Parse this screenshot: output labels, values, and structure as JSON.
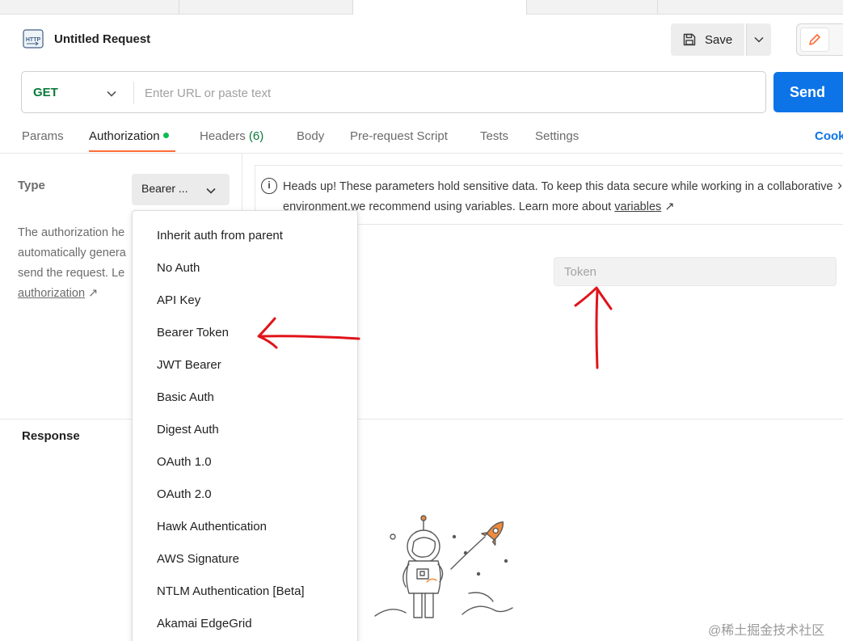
{
  "request": {
    "title": "Untitled Request",
    "http_badge": "HTTP",
    "save_label": "Save",
    "method": "GET",
    "url_placeholder": "Enter URL or paste text",
    "send_label": "Send"
  },
  "tabs": [
    {
      "label": "Params"
    },
    {
      "label": "Authorization",
      "active": true,
      "dot": true
    },
    {
      "label": "Headers",
      "count": "(6)"
    },
    {
      "label": "Body"
    },
    {
      "label": "Pre-request Script"
    },
    {
      "label": "Tests"
    },
    {
      "label": "Settings"
    }
  ],
  "cookies_label": "Cook",
  "auth": {
    "type_label": "Type",
    "selected_type": "Bearer ...",
    "description": {
      "line1": "The authorization he",
      "line2": "automatically genera",
      "line3": "send the request. Le",
      "link": "authorization",
      "link_arrow": "↗"
    }
  },
  "banner": {
    "text": "Heads up! These parameters hold sensitive data. To keep this data secure while working in a collaborative environment,we recommend using variables. Learn more about ",
    "link": "variables",
    "link_arrow": "↗"
  },
  "token_placeholder": "Token",
  "dropdown": {
    "items": [
      "Inherit auth from parent",
      "No Auth",
      "API Key",
      "Bearer Token",
      "JWT Bearer",
      "Basic Auth",
      "Digest Auth",
      "OAuth 1.0",
      "OAuth 2.0",
      "Hawk Authentication",
      "AWS Signature",
      "NTLM Authentication [Beta]",
      "Akamai EdgeGrid"
    ]
  },
  "response_label": "Response",
  "watermark": "@稀土掘金技术社区",
  "colors": {
    "accent_orange": "#ff6c37",
    "send_blue": "#0d74e7",
    "method_green": "#0b7a3b",
    "annotation_red": "#e0141a"
  }
}
